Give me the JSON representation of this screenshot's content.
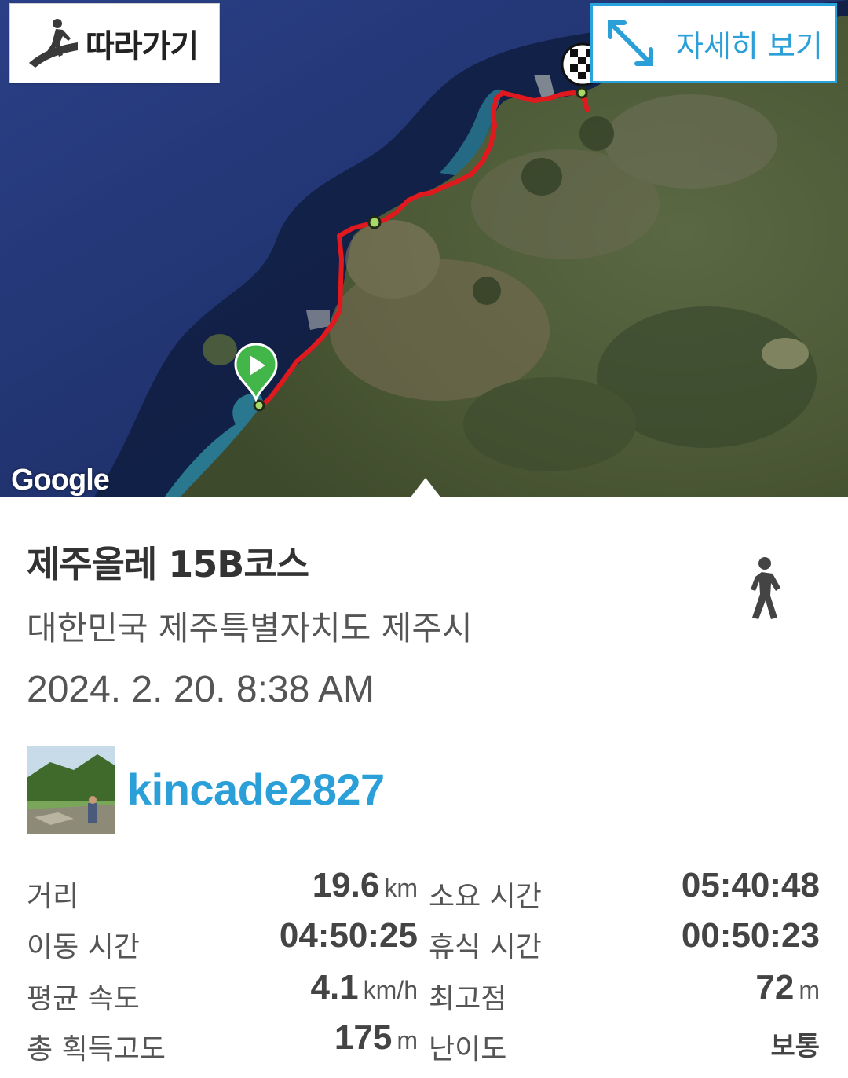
{
  "map": {
    "follow_label": "따라가기",
    "detail_label": "자세히 보기",
    "google_logo": "Google"
  },
  "track": {
    "title": "제주올레 15B코스",
    "location": "대한민국 제주특별자치도 제주시",
    "datetime": "2024. 2. 20. 8:38 AM",
    "activity_icon": "walking-icon"
  },
  "user": {
    "name": "kincade2827"
  },
  "stats": {
    "distance_label": "거리",
    "distance_value": "19.6",
    "distance_unit": "km",
    "total_time_label": "소요 시간",
    "total_time_value": "05:40:48",
    "moving_time_label": "이동 시간",
    "moving_time_value": "04:50:25",
    "rest_time_label": "휴식 시간",
    "rest_time_value": "00:50:23",
    "avg_speed_label": "평균 속도",
    "avg_speed_value": "4.1",
    "avg_speed_unit": "km/h",
    "max_alt_label": "최고점",
    "max_alt_value": "72",
    "max_alt_unit": "m",
    "elev_gain_label": "총 획득고도",
    "elev_gain_value": "175",
    "elev_gain_unit": "m",
    "difficulty_label": "난이도",
    "difficulty_value": "보통"
  },
  "colors": {
    "accent": "#2a9fd8",
    "route": "#e0191e",
    "sea": "#1b2f6a",
    "land": "#4e5a3a"
  }
}
